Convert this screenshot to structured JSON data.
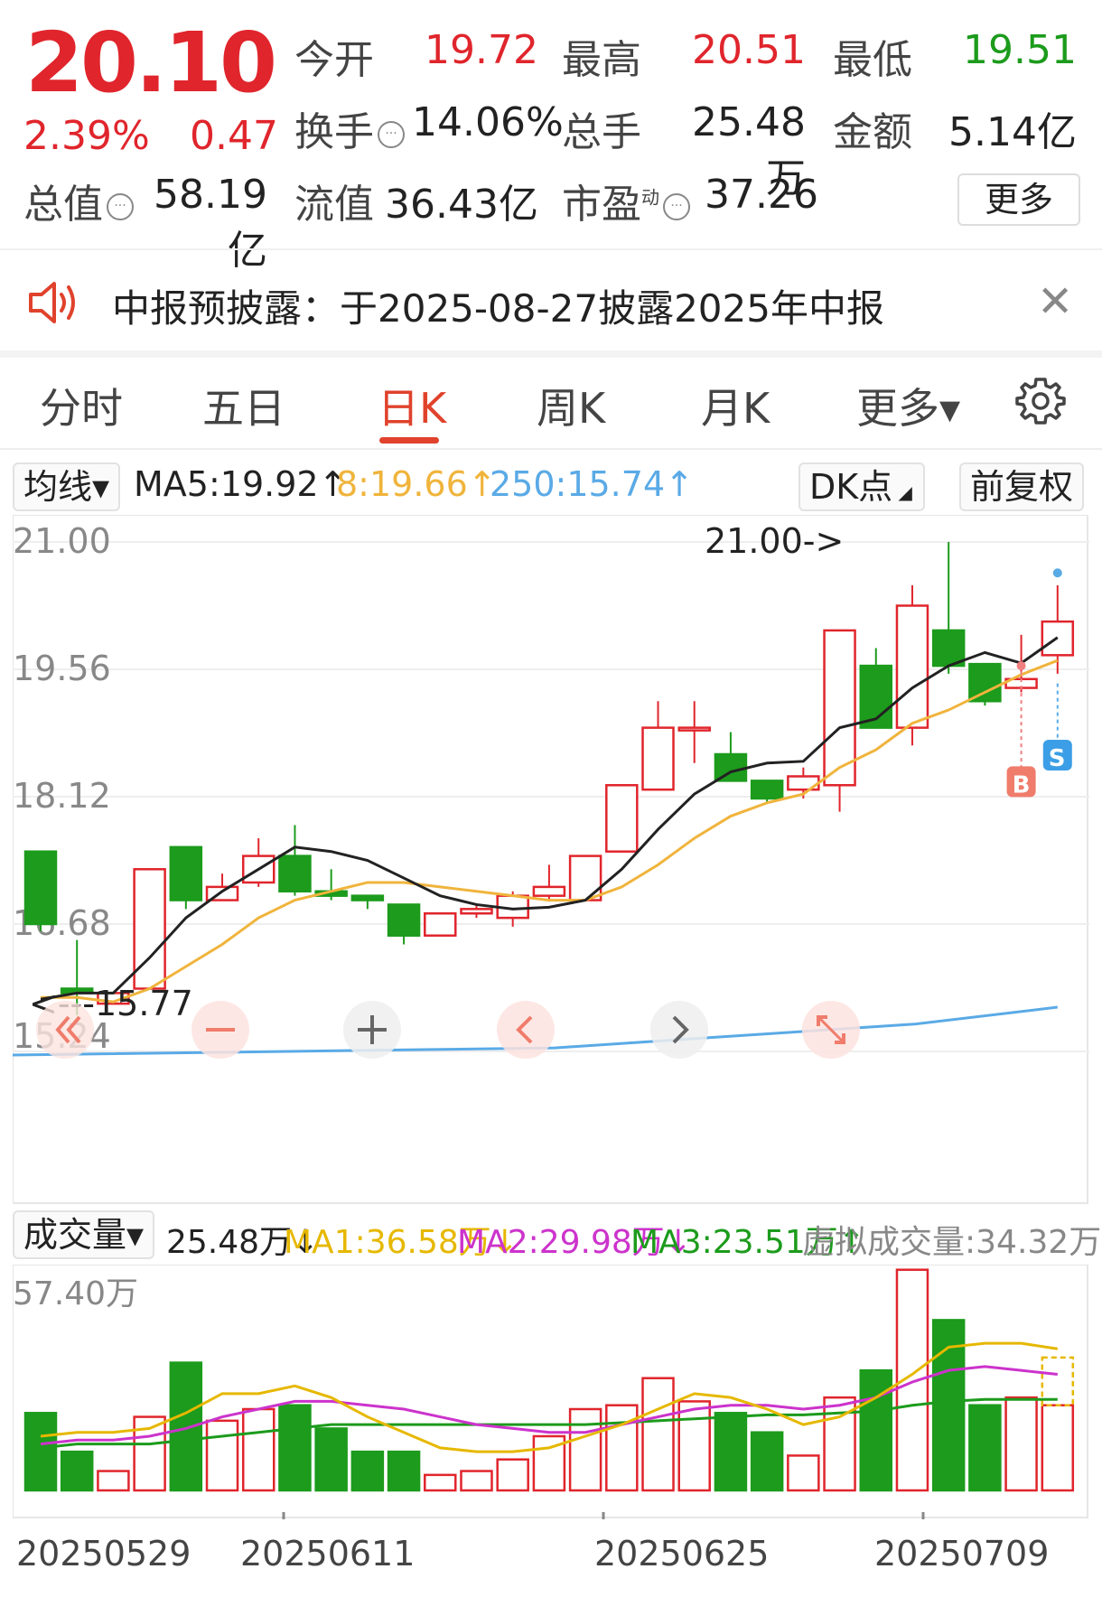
{
  "quote": {
    "price": "20.10",
    "pct": "2.39%",
    "change": "0.47",
    "open_label": "今开",
    "open": "19.72",
    "high_label": "最高",
    "high": "20.51",
    "low_label": "最低",
    "low": "19.51",
    "turnover_label": "换手",
    "turnover": "14.06%",
    "volume_label": "总手",
    "volume": "25.48万",
    "amount_label": "金额",
    "amount": "5.14亿",
    "mktcap_label": "总值",
    "mktcap": "58.19亿",
    "float_label": "流值",
    "float": "36.43亿",
    "pe_label": "市盈",
    "pe_sup": "动",
    "pe": "37.26",
    "more_label": "更多"
  },
  "notice": {
    "text": "中报预披露：于2025-08-27披露2025年中报"
  },
  "tabs": [
    {
      "label": "分时"
    },
    {
      "label": "五日"
    },
    {
      "label": "日K"
    },
    {
      "label": "周K"
    },
    {
      "label": "月K"
    },
    {
      "label": "更多▾"
    }
  ],
  "indicator": {
    "ma_select": "均线▾",
    "ma5": "MA5:19.92↑",
    "ma8": "8:19.66↑",
    "ma250": "250:15.74↑",
    "dk": "DK点",
    "adjust": "前复权"
  },
  "chart_data": {
    "type": "candlestick",
    "y_ticks": [
      "21.00",
      "19.56",
      "18.12",
      "16.68",
      "15.24"
    ],
    "ylim": [
      15.24,
      21.0
    ],
    "max_label": "21.00->",
    "min_label": "<---15.77",
    "candles": [
      {
        "o": 17.5,
        "c": 16.68,
        "h": 16.85,
        "l": 16.6
      },
      {
        "o": 15.95,
        "c": 15.9,
        "h": 16.5,
        "l": 15.65
      },
      {
        "o": 15.78,
        "c": 15.9,
        "h": 15.9,
        "l": 15.77
      },
      {
        "o": 15.95,
        "c": 17.3,
        "h": 17.3,
        "l": 15.95
      },
      {
        "o": 17.55,
        "c": 16.95,
        "h": 17.55,
        "l": 16.85
      },
      {
        "o": 16.95,
        "c": 17.1,
        "h": 17.25,
        "l": 16.95
      },
      {
        "o": 17.15,
        "c": 17.45,
        "h": 17.65,
        "l": 17.1
      },
      {
        "o": 17.45,
        "c": 17.05,
        "h": 17.8,
        "l": 17.0
      },
      {
        "o": 17.05,
        "c": 17.0,
        "h": 17.3,
        "l": 16.95
      },
      {
        "o": 17.0,
        "c": 16.95,
        "h": 17.0,
        "l": 16.85
      },
      {
        "o": 16.9,
        "c": 16.55,
        "h": 16.9,
        "l": 16.45
      },
      {
        "o": 16.55,
        "c": 16.8,
        "h": 16.8,
        "l": 16.55
      },
      {
        "o": 16.8,
        "c": 16.85,
        "h": 16.9,
        "l": 16.75
      },
      {
        "o": 16.75,
        "c": 17.0,
        "h": 17.05,
        "l": 16.65
      },
      {
        "o": 17.0,
        "c": 17.1,
        "h": 17.35,
        "l": 16.95
      },
      {
        "o": 16.95,
        "c": 17.45,
        "h": 17.45,
        "l": 16.95
      },
      {
        "o": 17.5,
        "c": 18.25,
        "h": 18.25,
        "l": 17.5
      },
      {
        "o": 18.2,
        "c": 18.9,
        "h": 19.2,
        "l": 18.2
      },
      {
        "o": 18.9,
        "c": 18.9,
        "h": 19.2,
        "l": 18.5
      },
      {
        "o": 18.6,
        "c": 18.3,
        "h": 18.85,
        "l": 18.3
      },
      {
        "o": 18.3,
        "c": 18.1,
        "h": 18.3,
        "l": 18.05
      },
      {
        "o": 18.2,
        "c": 18.35,
        "h": 18.45,
        "l": 18.1
      },
      {
        "o": 18.25,
        "c": 20.0,
        "h": 20.0,
        "l": 17.95
      },
      {
        "o": 19.6,
        "c": 18.9,
        "h": 19.8,
        "l": 18.9
      },
      {
        "o": 18.9,
        "c": 20.28,
        "h": 20.51,
        "l": 18.7
      },
      {
        "o": 20.0,
        "c": 19.6,
        "h": 21.0,
        "l": 19.51
      },
      {
        "o": 19.62,
        "c": 19.2,
        "h": 19.62,
        "l": 19.15
      },
      {
        "o": 19.35,
        "c": 19.45,
        "h": 19.95,
        "l": 19.3
      },
      {
        "o": 19.72,
        "c": 20.1,
        "h": 20.51,
        "l": 19.51
      }
    ],
    "ma5_series": [
      15.83,
      15.9,
      15.9,
      16.3,
      16.75,
      17.05,
      17.3,
      17.55,
      17.5,
      17.4,
      17.2,
      17.0,
      16.9,
      16.85,
      16.87,
      16.95,
      17.3,
      17.75,
      18.15,
      18.4,
      18.5,
      18.52,
      18.9,
      19.0,
      19.35,
      19.6,
      19.75,
      19.63,
      19.92
    ],
    "ma8_series": [
      15.85,
      15.85,
      15.8,
      15.95,
      16.2,
      16.45,
      16.75,
      16.95,
      17.05,
      17.15,
      17.15,
      17.1,
      17.05,
      17.0,
      16.95,
      16.95,
      17.1,
      17.35,
      17.65,
      17.9,
      18.05,
      18.15,
      18.45,
      18.65,
      18.95,
      19.1,
      19.3,
      19.5,
      19.66
    ],
    "ma250_label": "250:15.74"
  },
  "volume": {
    "select": "成交量▾",
    "value": "25.48万↓",
    "ma1": "MA1:36.58万↓",
    "ma2": "MA2:29.98万↓",
    "ma3": "MA3:23.51万↑",
    "virtual": "虚拟成交量:34.32万",
    "top_label": "57.40万",
    "bars": [
      20,
      10,
      5,
      19,
      33,
      18,
      21,
      22,
      16,
      10,
      10,
      4,
      5,
      8,
      14,
      21,
      22,
      29,
      23,
      20,
      15,
      9,
      24,
      31,
      57,
      44,
      22,
      24,
      22
    ]
  },
  "dates": [
    "20250529",
    "20250611",
    "20250625",
    "20250709"
  ],
  "colors": {
    "red": "#e0252c",
    "green": "#1c9b1c",
    "ma5": "#222222",
    "ma8": "#f0b43c",
    "ma250": "#5aaae6",
    "ma2": "#cc33cc"
  }
}
